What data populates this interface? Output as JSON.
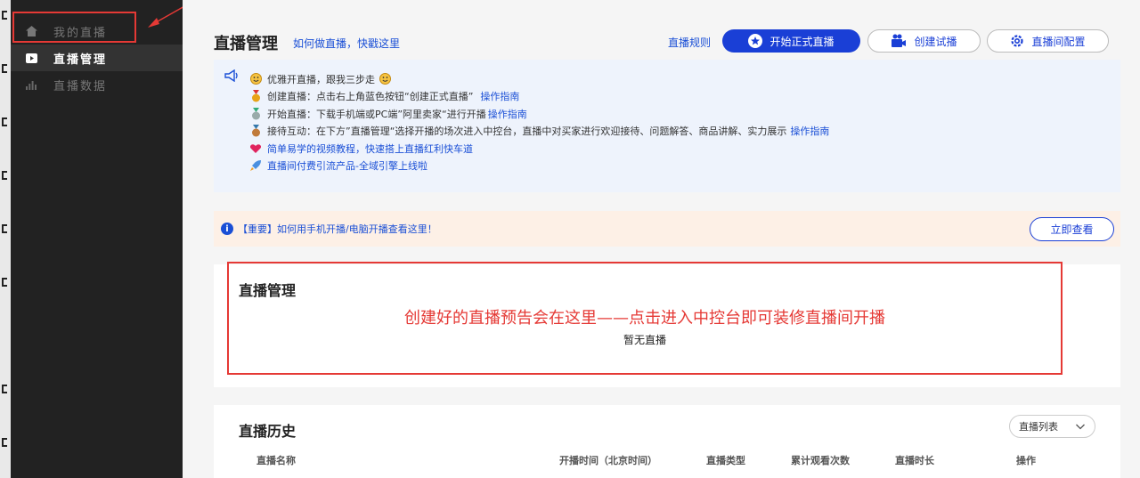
{
  "sidebar": {
    "items": [
      {
        "label": "我的直播",
        "icon": "home-icon",
        "active": false
      },
      {
        "label": "直播管理",
        "icon": "video-icon",
        "active": true
      },
      {
        "label": "直播数据",
        "icon": "bar-chart-icon",
        "active": false
      }
    ]
  },
  "header": {
    "title": "直播管理",
    "help_link": "如何做直播，快戳这里",
    "rules_link": "直播规则",
    "start_live_button": "开始正式直播",
    "trial_button": "创建试播",
    "config_button": "直播间配置"
  },
  "tips": {
    "lines": [
      {
        "icon": "smile-icon",
        "text": "优雅开直播，跟我三步走",
        "link": ""
      },
      {
        "icon": "gold-medal-icon",
        "text": "创建直播：点击右上角蓝色按钮“创建正式直播”",
        "link": "操作指南"
      },
      {
        "icon": "silver-medal-icon",
        "text": "开始直播：下载手机端或PC端”阿里卖家“进行开播",
        "link": "操作指南"
      },
      {
        "icon": "bronze-medal-icon",
        "text": "接待互动：在下方”直播管理“选择开播的场次进入中控台，直播中对买家进行欢迎接待、问题解答、商品讲解、实力展示",
        "link": "操作指南"
      },
      {
        "icon": "heart-icon",
        "text": "",
        "link": "简单易学的视频教程，快速搭上直播红利快车道"
      },
      {
        "icon": "rocket-icon",
        "text": "",
        "link": "直播间付费引流产品-全域引擎上线啦"
      }
    ]
  },
  "notice": {
    "text": "【重要】如何用手机开播/电脑开播查看这里！",
    "button": "立即查看"
  },
  "live_manage": {
    "title": "直播管理",
    "annotation": "创建好的直播预告会在这里——点击进入中控台即可装修直播间开播",
    "empty": "暂无直播"
  },
  "history": {
    "title": "直播历史",
    "select_value": "直播列表",
    "columns": [
      "直播名称",
      "开播时间（北京时间）",
      "直播类型",
      "累计观看次数",
      "直播时长",
      "操作"
    ]
  },
  "colors": {
    "primary": "#1a3fd6",
    "annotation": "#e53935",
    "sidebar": "#222222"
  }
}
